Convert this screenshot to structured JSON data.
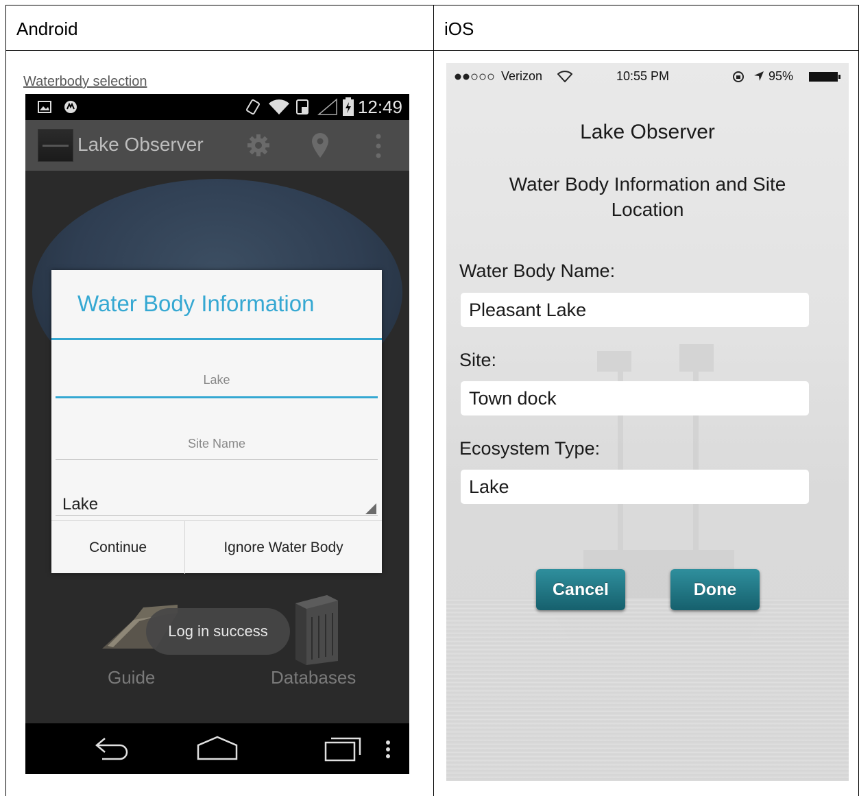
{
  "table": {
    "headers": [
      "Android",
      "iOS"
    ]
  },
  "android": {
    "caption": "Waterbody selection",
    "status_time": "12:49",
    "app_title": "Lake Observer",
    "dialog": {
      "title": "Water Body Information",
      "lake_placeholder": "Lake",
      "site_placeholder": "Site Name",
      "ecosystem_value": "Lake",
      "continue_label": "Continue",
      "ignore_label": "Ignore Water Body"
    },
    "toast": "Log in success",
    "guide_label": "Guide",
    "databases_label": "Databases",
    "accent_color": "#35a8d2"
  },
  "ios": {
    "carrier": "Verizon",
    "time": "10:55 PM",
    "battery": "95%",
    "app_title": "Lake Observer",
    "subtitle": "Water Body Information and Site Location",
    "fields": [
      {
        "label": "Water Body Name:",
        "value": "Pleasant Lake"
      },
      {
        "label": "Site:",
        "value": "Town dock"
      },
      {
        "label": "Ecosystem Type:",
        "value": "Lake"
      }
    ],
    "cancel_label": "Cancel",
    "done_label": "Done",
    "button_color": "#1f7684"
  }
}
